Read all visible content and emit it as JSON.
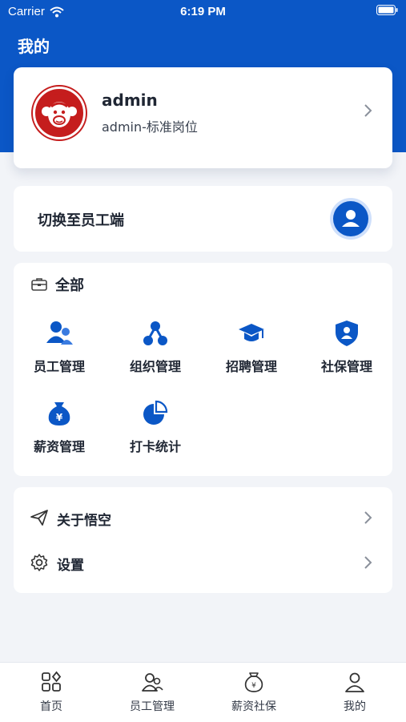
{
  "status_bar": {
    "carrier": "Carrier",
    "time": "6:19 PM"
  },
  "page": {
    "title": "我的"
  },
  "profile": {
    "name": "admin",
    "role": "admin-标准岗位"
  },
  "switch_role": {
    "label": "切换至员工端"
  },
  "all_section": {
    "title": "全部",
    "items": [
      {
        "label": "员工管理",
        "icon": "employees-icon"
      },
      {
        "label": "组织管理",
        "icon": "organization-icon"
      },
      {
        "label": "招聘管理",
        "icon": "graduation-cap-icon"
      },
      {
        "label": "社保管理",
        "icon": "shield-user-icon"
      },
      {
        "label": "薪资管理",
        "icon": "money-bag-icon"
      },
      {
        "label": "打卡统计",
        "icon": "pie-chart-icon"
      }
    ]
  },
  "menu": [
    {
      "label": "关于悟空",
      "icon": "paper-plane-icon"
    },
    {
      "label": "设置",
      "icon": "gear-icon"
    }
  ],
  "tabbar": [
    {
      "label": "首页",
      "icon": "grid-icon"
    },
    {
      "label": "员工管理",
      "icon": "users-icon"
    },
    {
      "label": "薪资社保",
      "icon": "money-bag-icon"
    },
    {
      "label": "我的",
      "icon": "user-icon",
      "active": true
    }
  ],
  "colors": {
    "primary": "#0b57c6",
    "background": "#f2f4f8",
    "avatar": "#c51d1d"
  }
}
